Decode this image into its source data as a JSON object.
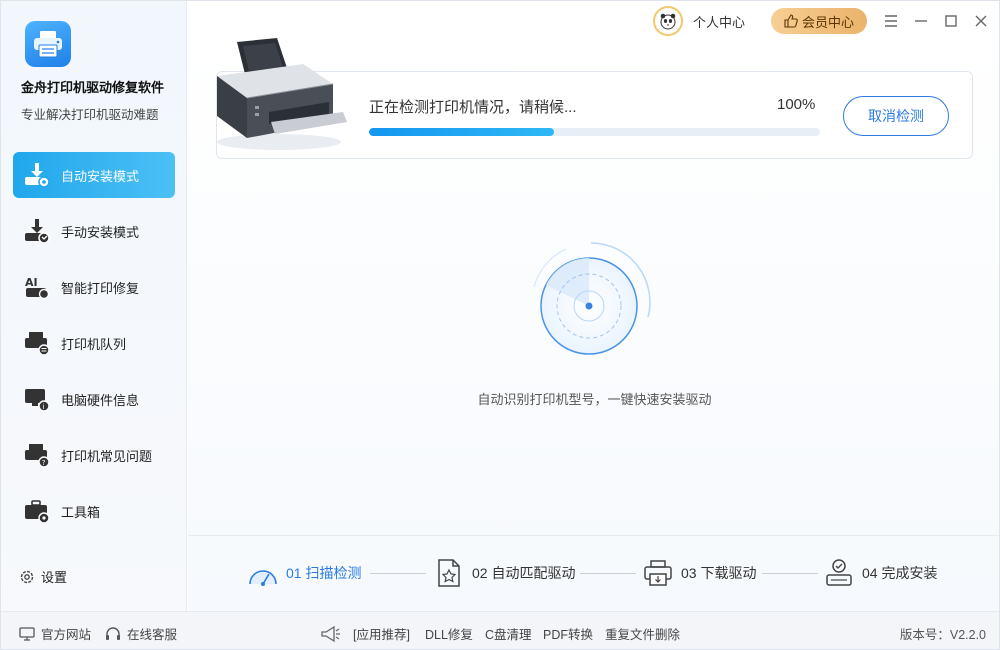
{
  "app": {
    "name": "金舟打印机驱动修复软件",
    "subtitle": "专业解决打印机驱动难题"
  },
  "sidebar": {
    "items": [
      {
        "label": "自动安装模式",
        "icon": "auto-install-icon",
        "active": true
      },
      {
        "label": "手动安装模式",
        "icon": "manual-install-icon",
        "active": false
      },
      {
        "label": "智能打印修复",
        "icon": "smart-repair-icon",
        "active": false
      },
      {
        "label": "打印机队列",
        "icon": "print-queue-icon",
        "active": false
      },
      {
        "label": "电脑硬件信息",
        "icon": "hardware-info-icon",
        "active": false
      },
      {
        "label": "打印机常见问题",
        "icon": "faq-icon",
        "active": false
      },
      {
        "label": "工具箱",
        "icon": "toolbox-icon",
        "active": false
      }
    ],
    "settings_label": "设置"
  },
  "topbar": {
    "user_center": "个人中心",
    "vip_center": "会员中心"
  },
  "detection": {
    "status": "正在检测打印机情况，请稍候...",
    "percent_text": "100%",
    "progress": 0.41,
    "cancel_label": "取消检测",
    "caption": "自动识别打印机型号，一键快速安装驱动"
  },
  "steps": [
    {
      "label": "01  扫描检测",
      "icon": "scan-icon",
      "active": true
    },
    {
      "label": "02  自动匹配驱动",
      "icon": "match-driver-icon",
      "active": false
    },
    {
      "label": "03  下载驱动",
      "icon": "download-driver-icon",
      "active": false
    },
    {
      "label": "04  完成安装",
      "icon": "install-complete-icon",
      "active": false
    }
  ],
  "footer": {
    "website": "官方网站",
    "support": "在线客服",
    "recommend": "[应用推荐]",
    "links": [
      "DLL修复",
      "C盘清理",
      "PDF转换",
      "重复文件删除"
    ],
    "version": "版本号：V2.2.0"
  },
  "colors": {
    "accent": "#2c7be5",
    "nav_active": "#20a7ec",
    "progress": "#1296f0",
    "vip": "#eab36a"
  }
}
